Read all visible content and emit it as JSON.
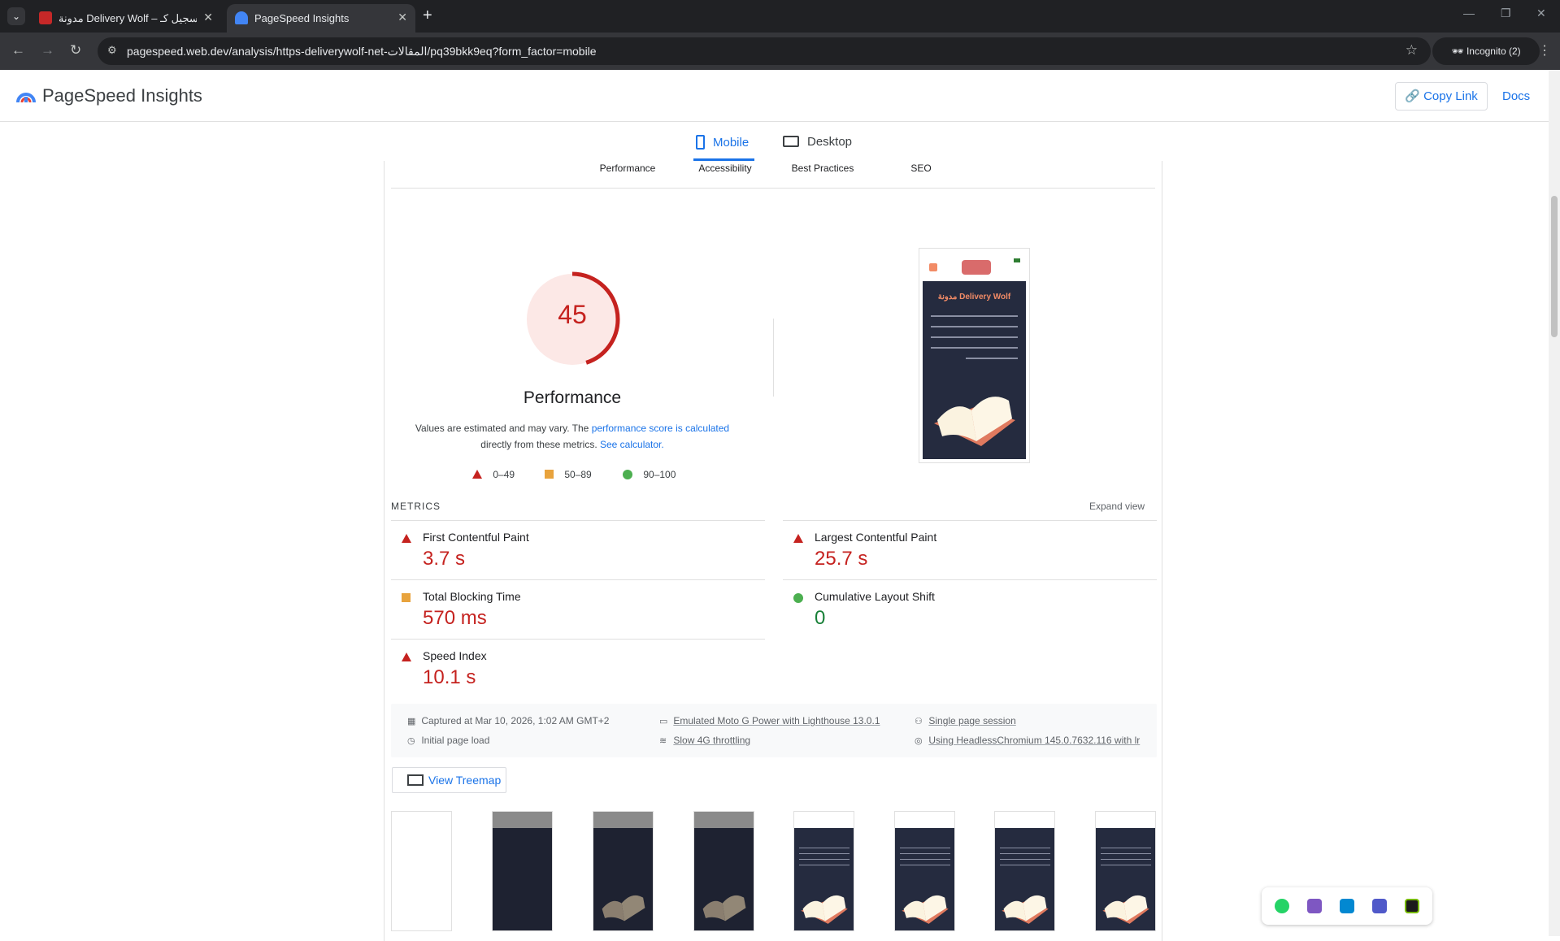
{
  "browser": {
    "tabs": [
      {
        "label": "مدونة Delivery Wolf – تسجيل كـ",
        "active": false
      },
      {
        "label": "PageSpeed Insights",
        "active": true
      }
    ],
    "url": "pagespeed.web.dev/analysis/https-deliverywolf-net-المقالات/pq39bkk9eq?form_factor=mobile",
    "incognito_label": "Incognito (2)"
  },
  "header": {
    "title": "PageSpeed Insights",
    "copy_link": "Copy Link",
    "docs": "Docs"
  },
  "device_tabs": {
    "mobile": "Mobile",
    "desktop": "Desktop",
    "selected": "Mobile"
  },
  "category_tabs": [
    "Performance",
    "Accessibility",
    "Best Practices",
    "SEO"
  ],
  "score": {
    "value": "45",
    "fraction": 0.45,
    "label": "Performance",
    "desc_1": "Values are estimated and may vary. The",
    "desc_link_1": "performance score is calculated",
    "desc_2": "directly from these metrics.",
    "desc_link_2": "See calculator.",
    "color": "#c5221f"
  },
  "legend": {
    "fail": "0–49",
    "average": "50–89",
    "pass": "90–100"
  },
  "screenshot": {
    "site_title": "مدونة Delivery Wolf"
  },
  "metrics": {
    "heading": "METRICS",
    "expand": "Expand view",
    "fcp": {
      "label": "First Contentful Paint",
      "value": "3.7 s",
      "rating": "fail"
    },
    "lcp": {
      "label": "Largest Contentful Paint",
      "value": "25.7 s",
      "rating": "fail"
    },
    "tbt": {
      "label": "Total Blocking Time",
      "value": "570 ms",
      "rating": "average"
    },
    "cls": {
      "label": "Cumulative Layout Shift",
      "value": "0",
      "rating": "pass"
    },
    "si": {
      "label": "Speed Index",
      "value": "10.1 s",
      "rating": "fail"
    }
  },
  "info": {
    "captured": "Captured at Mar 10, 2026, 1:02 AM GMT+2",
    "load": "Initial page load",
    "device": "Emulated Moto G Power with Lighthouse 13.0.1",
    "throttling": "Slow 4G throttling",
    "session": "Single page session",
    "browser": "Using HeadlessChromium 145.0.7632.116 with lr"
  },
  "treemap": "View Treemap",
  "colors": {
    "accent": "#1a73e8",
    "fail": "#c5221f",
    "average": "#e8a33d",
    "pass": "#4caf50"
  }
}
